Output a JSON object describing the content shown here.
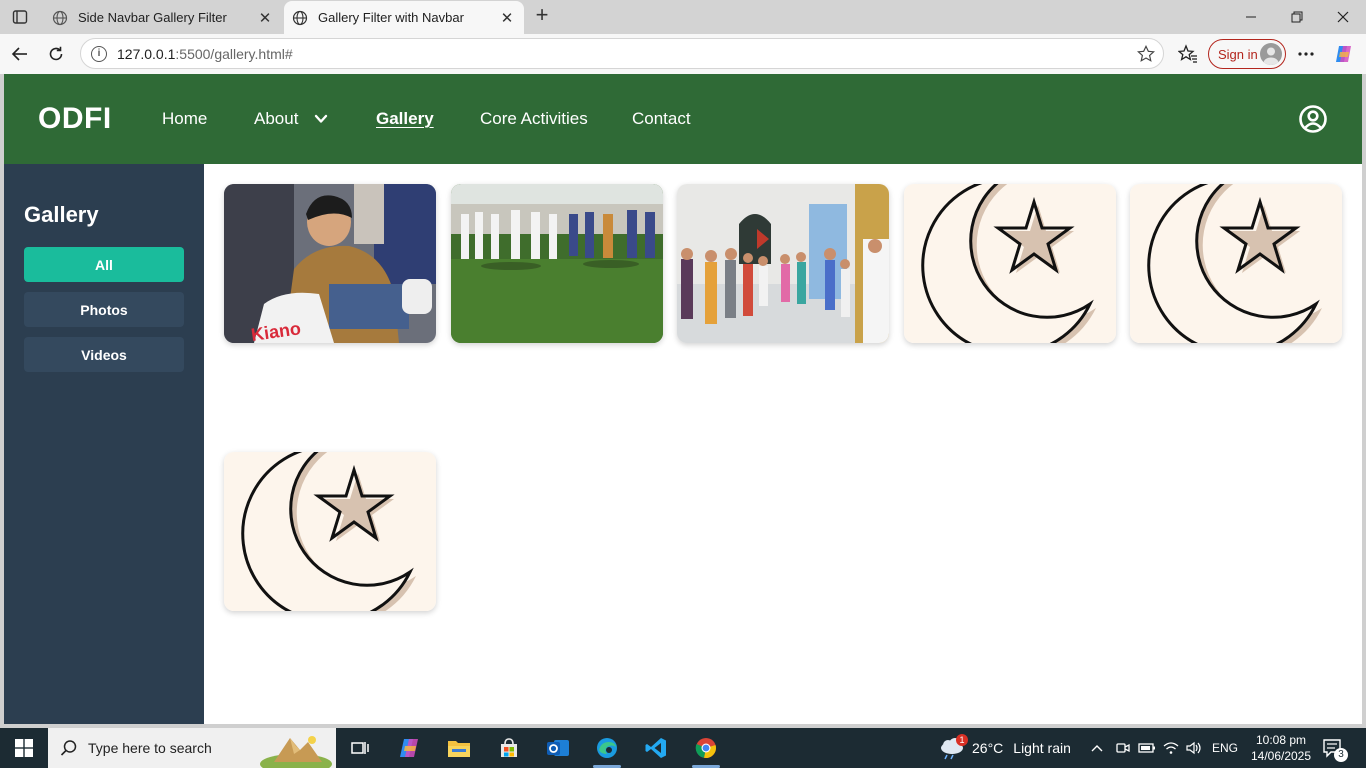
{
  "browser": {
    "tabs": [
      {
        "title": "Side Navbar Gallery Filter",
        "active": false
      },
      {
        "title": "Gallery Filter with Navbar",
        "active": true
      }
    ],
    "url_host": "127.0.0.1",
    "url_rest": ":5500/gallery.html#",
    "sign_in_label": "Sign in"
  },
  "site": {
    "brand": "ODFI",
    "nav": [
      "Home",
      "About",
      "Gallery",
      "Core Activities",
      "Contact"
    ],
    "current": "Gallery",
    "colors": {
      "navbar": "#2f6a36",
      "sidebar": "#2c3e50",
      "active_filter": "#1abc9c",
      "filter": "#34495e"
    }
  },
  "sidebar": {
    "title": "Gallery",
    "filters": [
      "All",
      "Photos",
      "Videos"
    ],
    "active_filter": "All"
  },
  "gallery": {
    "items": [
      {
        "kind": "photo",
        "subject": "man-kneeling-with-bags"
      },
      {
        "kind": "photo",
        "subject": "outdoor-congregation-on-grass"
      },
      {
        "kind": "photo",
        "subject": "group-standing-in-hall"
      },
      {
        "kind": "placeholder",
        "subject": "crescent-and-star"
      },
      {
        "kind": "placeholder",
        "subject": "crescent-and-star"
      },
      {
        "kind": "placeholder",
        "subject": "crescent-and-star"
      }
    ]
  },
  "taskbar": {
    "search_placeholder": "Type here to search",
    "weather_temp": "26°C",
    "weather_text": "Light rain",
    "weather_badge": "1",
    "language": "ENG",
    "time": "10:08 pm",
    "date": "14/06/2025",
    "notification_count": "3"
  }
}
